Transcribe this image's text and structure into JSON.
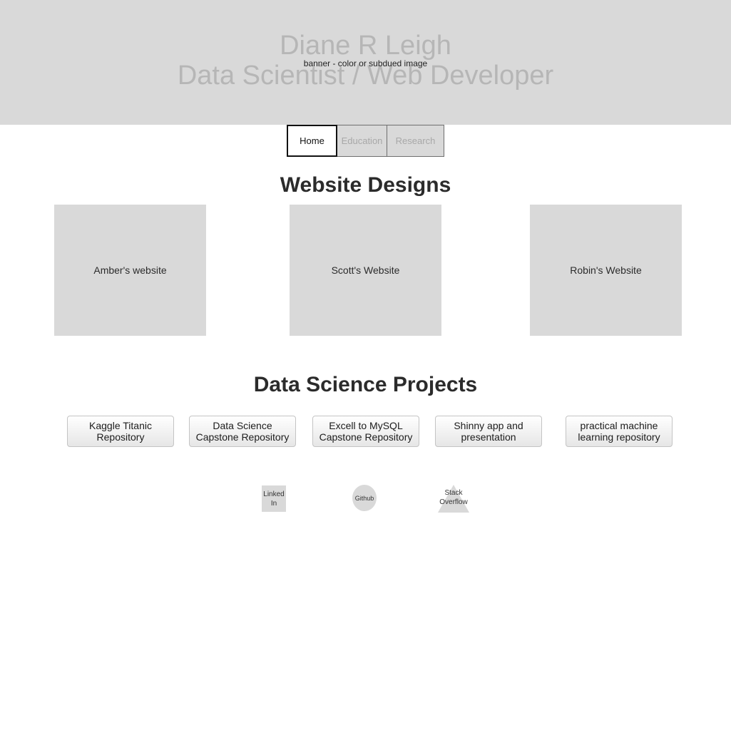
{
  "banner": {
    "name": "Diane R Leigh",
    "role": "Data Scientist / Web Developer",
    "note": "banner - color or subdued image"
  },
  "nav": {
    "tabs": [
      {
        "label": "Home",
        "active": true
      },
      {
        "label": "Education",
        "active": false
      },
      {
        "label": "Research",
        "active": false
      }
    ]
  },
  "website_designs": {
    "title": "Website Designs",
    "cards": [
      {
        "label": "Amber's website"
      },
      {
        "label": "Scott's Website"
      },
      {
        "label": "Robin's Website"
      }
    ]
  },
  "data_science": {
    "title": "Data Science Projects",
    "projects": [
      {
        "label": "Kaggle Titanic Repository"
      },
      {
        "label": "Data Science Capstone Repository"
      },
      {
        "label": "Excell to MySQL Capstone Repository"
      },
      {
        "label": "Shinny app and presentation"
      },
      {
        "label": "practical machine learning repository"
      }
    ]
  },
  "social": {
    "linkedin": "Linked In",
    "github": "Github",
    "stackoverflow": "Stack Overflow"
  },
  "colors": {
    "placeholder_gray": "#d9d9d9",
    "banner_text": "#b6b6b6",
    "heading_text": "#2b2b2b"
  }
}
